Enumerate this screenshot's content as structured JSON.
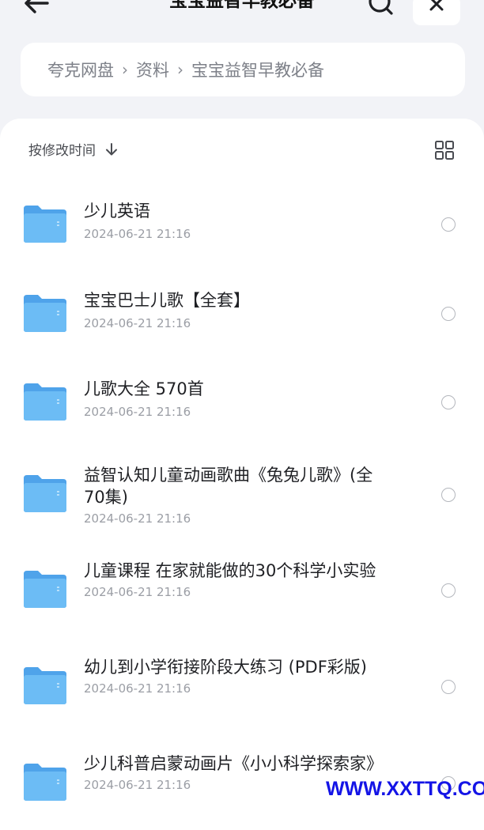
{
  "header": {
    "title": "宝宝益智早教必备"
  },
  "breadcrumb": {
    "items": [
      "夸克网盘",
      "资料",
      "宝宝益智早教必备"
    ],
    "separator": "›"
  },
  "toolbar": {
    "sort_label": "按修改时间"
  },
  "files": [
    {
      "name": "少儿英语",
      "date": "2024-06-21 21:16"
    },
    {
      "name": "宝宝巴士儿歌【全套】",
      "date": "2024-06-21 21:16"
    },
    {
      "name": "儿歌大全 570首",
      "date": "2024-06-21 21:16"
    },
    {
      "name": "益智认知儿童动画歌曲《兔兔儿歌》(全70集)",
      "date": "2024-06-21 21:16"
    },
    {
      "name": "儿童课程 在家就能做的30个科学小实验",
      "date": "2024-06-21 21:16"
    },
    {
      "name": "幼儿到小学衔接阶段大练习 (PDF彩版)",
      "date": "2024-06-21 21:16"
    },
    {
      "name": "少儿科普启蒙动画片《小小科学探索家》",
      "date": "2024-06-21 21:16"
    }
  ],
  "watermark": {
    "text": "WWW.XXTTQ.COM"
  },
  "colors": {
    "background": "#f2f3f7",
    "folder": "#5fb0f0",
    "watermark": "#1414e6"
  },
  "icons": [
    "back-arrow-icon",
    "search-icon",
    "close-icon",
    "sort-down-arrow-icon",
    "grid-view-icon",
    "folder-icon",
    "radio-circle-icon"
  ]
}
